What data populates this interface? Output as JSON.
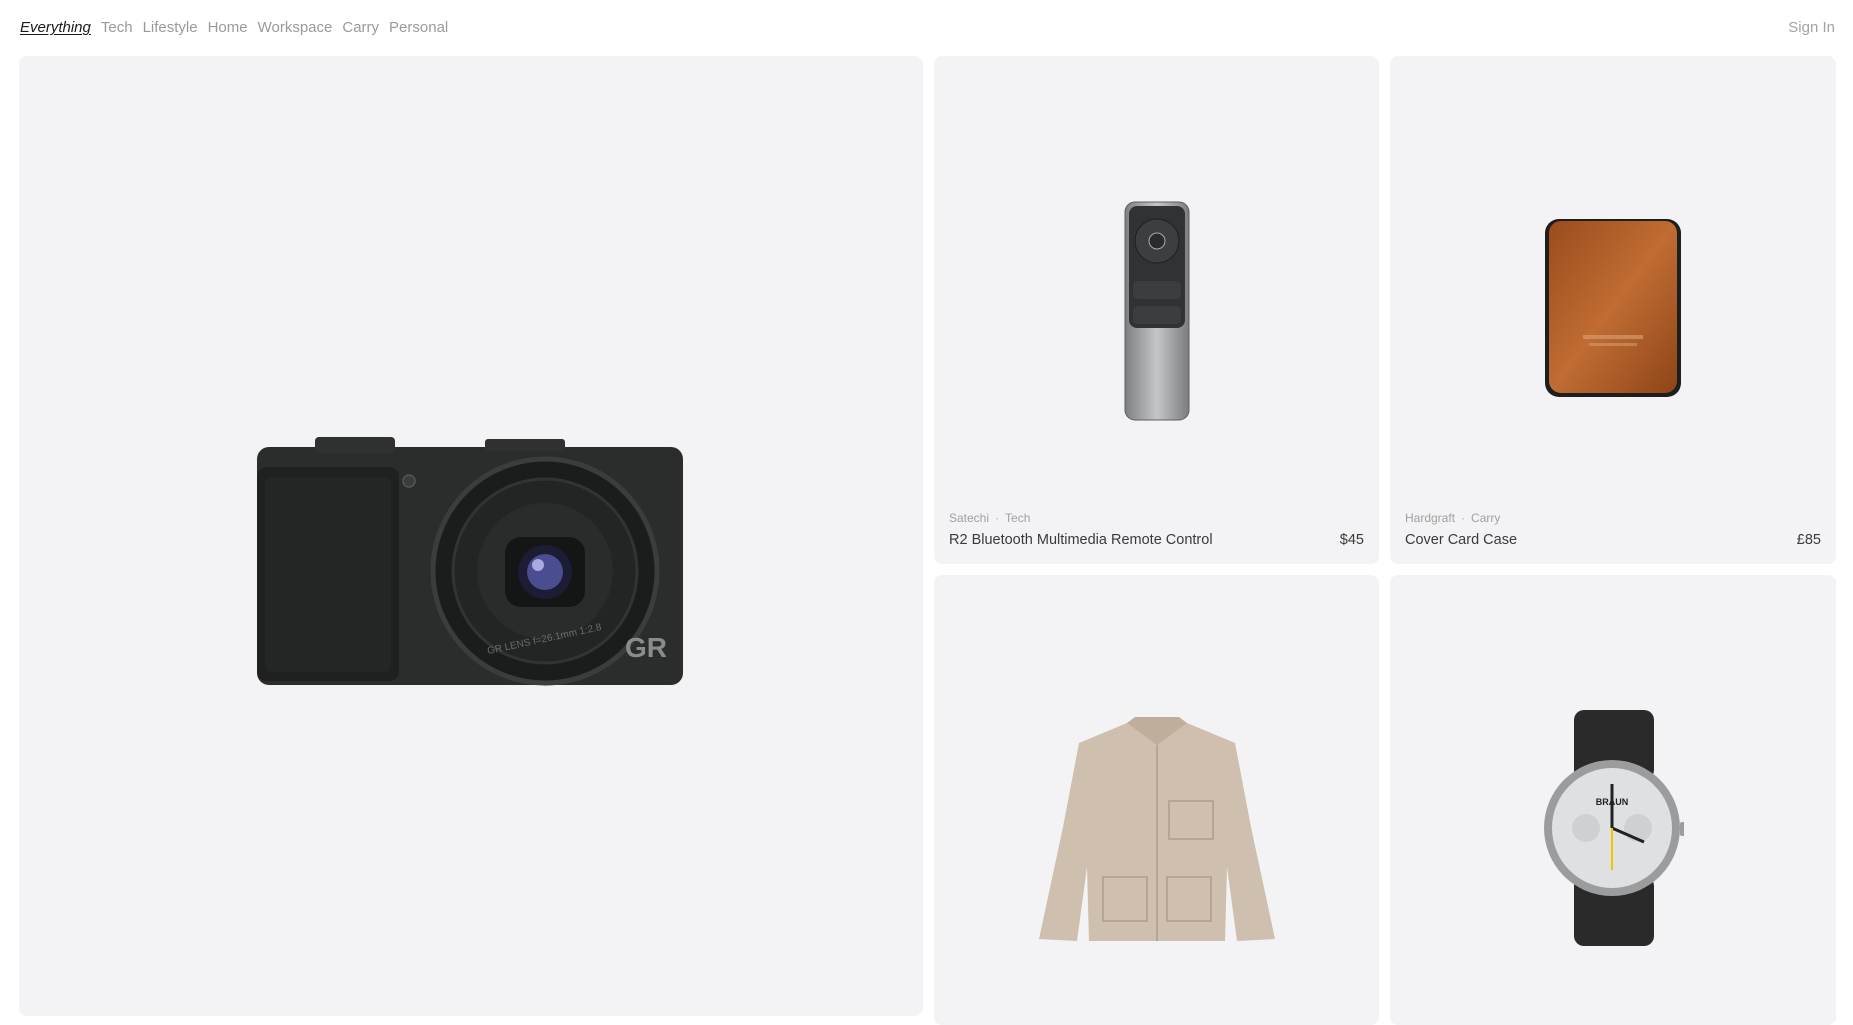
{
  "nav": {
    "items": [
      "Everything",
      "Tech",
      "Lifestyle",
      "Home",
      "Workspace",
      "Carry",
      "Personal"
    ],
    "active": "Everything",
    "sign_in": "Sign In"
  },
  "products": [
    {
      "brand": "",
      "category": "",
      "name": "",
      "price": "",
      "image": "camera"
    },
    {
      "brand": "Satechi",
      "category": "Tech",
      "name": "R2 Bluetooth Multimedia Remote Control",
      "price": "$45",
      "image": "remote-control"
    },
    {
      "brand": "Hardgraft",
      "category": "Carry",
      "name": "Cover Card Case",
      "price": "£85",
      "image": "leather-card-case"
    },
    {
      "brand": "",
      "category": "",
      "name": "",
      "price": "",
      "image": "chore-jacket"
    },
    {
      "brand": "",
      "category": "",
      "name": "",
      "price": "",
      "image": "chronograph-watch"
    }
  ],
  "colors": {
    "card_bg": "#f3f3f5",
    "text_muted": "#9a9a9a",
    "leather": "#b05f27"
  },
  "image_text": {
    "camera_badge": "GR",
    "camera_lens": "GR LENS f=26.1mm 1:2.8",
    "watch_brand": "BRAUN"
  }
}
